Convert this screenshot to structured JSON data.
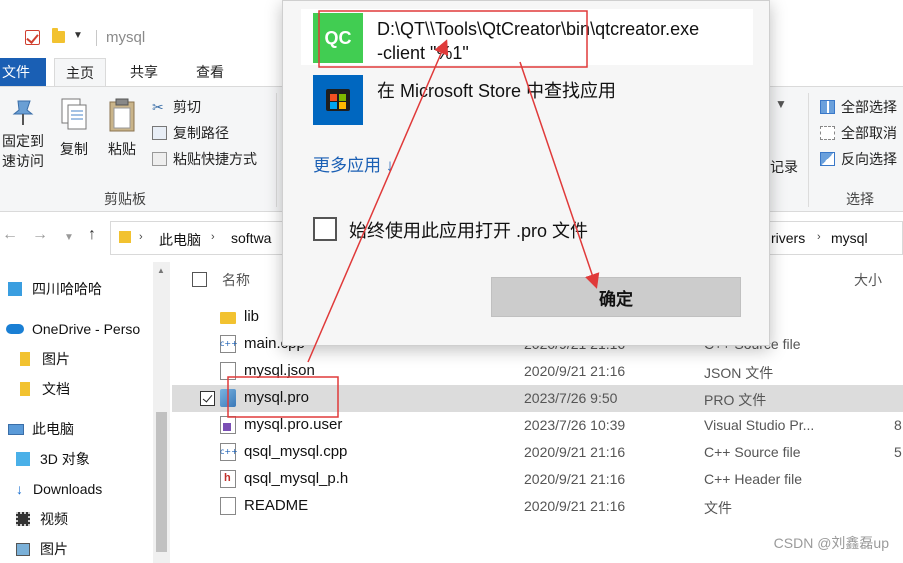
{
  "window": {
    "title": "mysql"
  },
  "ribbon_tabs": {
    "file": "文件",
    "home": "主页",
    "share": "共享",
    "view": "查看"
  },
  "clipboard": {
    "pin_line1": "固定到",
    "pin_line2": "速访问",
    "copy": "复制",
    "paste": "粘贴",
    "cut": "剪切",
    "copy_path": "复制路径",
    "paste_shortcut": "粘贴快捷方式",
    "group_label": "剪贴板"
  },
  "right_ribbon": {
    "history": "记录",
    "select_all": "全部选择",
    "select_none": "全部取消",
    "invert": "反向选择",
    "group_label": "选择"
  },
  "address": {
    "crumbs": [
      "此电脑",
      "softwa",
      "rivers",
      "mysql"
    ]
  },
  "nav": {
    "items": [
      "四川哈哈哈",
      "OneDrive - Perso",
      "图片",
      "文档",
      "此电脑",
      "3D 对象",
      "Downloads",
      "视频",
      "图片"
    ]
  },
  "files": {
    "col_name": "名称",
    "col_size": "大小",
    "rows": [
      {
        "name": "lib",
        "date": "",
        "type": "",
        "size": ""
      },
      {
        "name": "main.cpp",
        "date": "2020/9/21 21:16",
        "type": "C++ Source file",
        "size": ""
      },
      {
        "name": "mysql.json",
        "date": "2020/9/21 21:16",
        "type": "JSON 文件",
        "size": ""
      },
      {
        "name": "mysql.pro",
        "date": "2023/7/26 9:50",
        "type": "PRO 文件",
        "size": ""
      },
      {
        "name": "mysql.pro.user",
        "date": "2023/7/26 10:39",
        "type": "Visual Studio Pr...",
        "size": "8"
      },
      {
        "name": "qsql_mysql.cpp",
        "date": "2020/9/21 21:16",
        "type": "C++ Source file",
        "size": "5"
      },
      {
        "name": "qsql_mysql_p.h",
        "date": "2020/9/21 21:16",
        "type": "C++ Header file",
        "size": ""
      },
      {
        "name": "README",
        "date": "2020/9/21 21:16",
        "type": "文件",
        "size": ""
      }
    ]
  },
  "popup": {
    "qt_icon_text": "QC",
    "qt_line1": "D:\\QT\\\\Tools\\QtCreator\\bin\\qtcreator.exe",
    "qt_line2": "-client \"%1\"",
    "store_label": "在 Microsoft Store 中查找应用",
    "more_apps": "更多应用 ↓",
    "always_use": "始终使用此应用打开 .pro 文件",
    "ok": "确定"
  },
  "watermark": "CSDN @刘鑫磊up",
  "colors": {
    "accent": "#1a5fb4",
    "annotation": "#e03a3a",
    "qt_green": "#41cd52"
  }
}
